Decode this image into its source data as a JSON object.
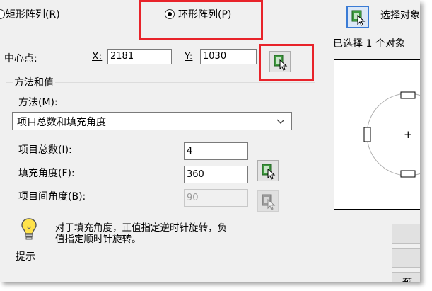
{
  "array_type": {
    "rect_label": "矩形阵列(R)",
    "polar_label": "环形阵列(P)"
  },
  "center": {
    "label": "中心点:",
    "x_label": "X:",
    "x_value": "2181",
    "y_label": "Y:",
    "y_value": "1030"
  },
  "method_group": {
    "title": "方法和值",
    "method_label": "方法(M):",
    "method_selected": "项目总数和填充角度",
    "total_items_label": "项目总数(I):",
    "total_items_value": "4",
    "fill_angle_label": "填充角度(F):",
    "fill_angle_value": "360",
    "item_angle_label": "项目间角度(B):",
    "item_angle_value": "90",
    "tip_label": "提示",
    "tip_text_line1": "对于填充角度，正值指定逆时针旋转，负",
    "tip_text_line2": "值指定顺时针旋转。"
  },
  "selection": {
    "select_objects_label": "选择对象",
    "selected_count": "已选择 1 个对象"
  },
  "preview": {
    "center_glyph": "+"
  },
  "sidebar": {
    "partial_label": "预"
  },
  "colors": {
    "highlight": "#e8232a",
    "dialog_bg": "#f0f0f0"
  }
}
